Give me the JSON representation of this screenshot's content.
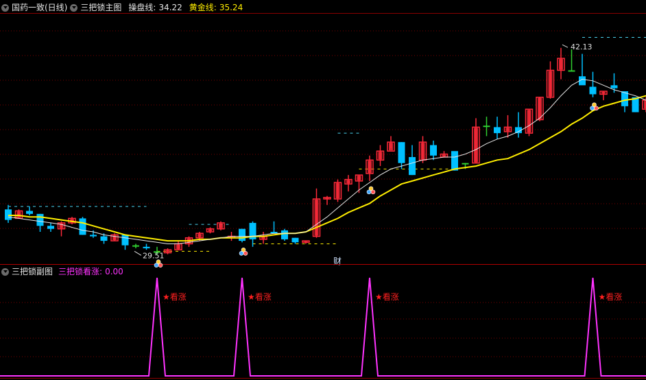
{
  "main": {
    "stock_title": "国药一致(日线)",
    "indicator_title": "三把锁主图",
    "line1_label": "操盘线:",
    "line1_value": "34.22",
    "line2_label": "黄金线:",
    "line2_value": "35.24",
    "high_label": "42.13",
    "low_label": "29.51",
    "marker": "财"
  },
  "sub": {
    "title": "三把锁副图",
    "series_label": "三把锁看涨:",
    "series_value": "0.00",
    "signal_label": "★看涨"
  },
  "colors": {
    "background": "#000000",
    "grid": "#7a0000",
    "up": "#ff2a3a",
    "down": "#00c0ff",
    "doji": "#30d030",
    "ma_white": "#e8e8e8",
    "ma_yellow": "#ffee00",
    "signal": "#ff33ff",
    "level": "#4cd2f0",
    "level_yellow": "#ffee00"
  },
  "chart_data": {
    "type": "candlestick",
    "price_range": [
      28.7,
      44.2
    ],
    "grid": true,
    "ohlc": [
      [
        31.3,
        31.6,
        30.4,
        30.6
      ],
      [
        30.7,
        31.3,
        30.7,
        31.2
      ],
      [
        31.2,
        31.5,
        30.9,
        31.0
      ],
      [
        31.0,
        31.0,
        29.8,
        30.2
      ],
      [
        30.2,
        30.4,
        29.8,
        30.0
      ],
      [
        30.0,
        30.5,
        29.5,
        30.4
      ],
      [
        30.4,
        30.8,
        30.3,
        30.7
      ],
      [
        30.7,
        30.8,
        29.6,
        29.6
      ],
      [
        29.6,
        29.9,
        29.4,
        29.5
      ],
      [
        29.5,
        29.7,
        29.0,
        29.2
      ],
      [
        29.2,
        29.7,
        29.2,
        29.6
      ],
      [
        29.6,
        29.6,
        28.6,
        28.9
      ],
      [
        28.9,
        29.0,
        28.7,
        28.9
      ],
      [
        28.8,
        29.0,
        28.6,
        28.7
      ],
      [
        28.5,
        28.8,
        28.3,
        28.5
      ],
      [
        28.4,
        28.7,
        28.3,
        28.6
      ],
      [
        28.6,
        29.2,
        28.6,
        29.0
      ],
      [
        29.0,
        29.5,
        28.8,
        29.4
      ],
      [
        29.4,
        29.8,
        29.2,
        29.7
      ],
      [
        29.8,
        30.1,
        29.7,
        30.0
      ],
      [
        30.0,
        30.5,
        29.9,
        30.4
      ],
      [
        29.4,
        29.8,
        29.2,
        29.5
      ],
      [
        30.0,
        30.0,
        29.1,
        29.2
      ],
      [
        30.4,
        30.5,
        28.8,
        29.3
      ],
      [
        29.3,
        29.8,
        29.0,
        29.5
      ],
      [
        29.8,
        30.5,
        29.7,
        29.7
      ],
      [
        29.9,
        30.0,
        29.2,
        29.3
      ],
      [
        29.4,
        29.4,
        29.0,
        29.1
      ],
      [
        29.1,
        29.2,
        29.0,
        29.2
      ],
      [
        29.5,
        32.7,
        29.4,
        32.0
      ],
      [
        32.0,
        32.2,
        31.6,
        32.1
      ],
      [
        32.0,
        33.3,
        31.8,
        33.1
      ],
      [
        33.0,
        33.6,
        32.5,
        33.3
      ],
      [
        33.2,
        33.6,
        32.4,
        33.6
      ],
      [
        33.7,
        34.9,
        33.2,
        34.6
      ],
      [
        34.6,
        35.6,
        34.2,
        35.2
      ],
      [
        35.2,
        36.2,
        35.4,
        35.8
      ],
      [
        35.8,
        35.8,
        34.0,
        34.4
      ],
      [
        34.8,
        35.6,
        33.6,
        33.6
      ],
      [
        34.6,
        36.2,
        34.4,
        35.8
      ],
      [
        35.6,
        35.9,
        34.6,
        34.9
      ],
      [
        34.8,
        35.2,
        34.8,
        35.0
      ],
      [
        35.2,
        34.6,
        33.9,
        33.9
      ],
      [
        34.4,
        34.4,
        34.0,
        34.4
      ],
      [
        34.4,
        37.4,
        34.4,
        36.8
      ],
      [
        36.9,
        37.5,
        36.2,
        36.9
      ],
      [
        36.8,
        37.5,
        36.0,
        36.4
      ],
      [
        36.5,
        37.6,
        36.1,
        36.8
      ],
      [
        36.8,
        37.8,
        36.1,
        36.4
      ],
      [
        36.4,
        38.0,
        36.2,
        38.0
      ],
      [
        37.3,
        38.8,
        37.2,
        38.8
      ],
      [
        38.8,
        41.2,
        38.7,
        40.6
      ],
      [
        40.6,
        42.1,
        40.0,
        41.4
      ],
      [
        40.6,
        42.0,
        40.6,
        40.6
      ],
      [
        40.2,
        41.7,
        40.0,
        39.6
      ],
      [
        39.5,
        40.5,
        38.8,
        39.0
      ],
      [
        39.0,
        39.2,
        38.6,
        39.2
      ],
      [
        39.6,
        40.4,
        39.1,
        39.4
      ],
      [
        39.2,
        38.8,
        37.8,
        38.2
      ],
      [
        38.8,
        38.3,
        37.8,
        37.8
      ],
      [
        38.0,
        38.8,
        37.8,
        38.6
      ],
      [
        38.3,
        39.2,
        37.9,
        38.8
      ],
      [
        38.6,
        38.8,
        36.4,
        36.8
      ],
      [
        36.8,
        36.4,
        35.4,
        35.9
      ],
      [
        35.6,
        36.2,
        35.3,
        35.6
      ],
      [
        35.6,
        35.8,
        35.3,
        35.6
      ],
      [
        35.6,
        35.8,
        35.4,
        35.6
      ],
      [
        35.6,
        35.8,
        35.4,
        35.8
      ],
      [
        36.0,
        36.5,
        35.7,
        36.3
      ],
      [
        36.6,
        37.1,
        36.4,
        37.1
      ],
      [
        37.0,
        37.6,
        36.5,
        37.2
      ],
      [
        37.0,
        37.8,
        36.8,
        37.5
      ],
      [
        37.1,
        38.0,
        37.0,
        37.4
      ],
      [
        37.6,
        37.5,
        36.8,
        36.9
      ],
      [
        36.4,
        36.6,
        35.5,
        35.7
      ],
      [
        35.8,
        35.8,
        34.3,
        34.8
      ]
    ],
    "ma_white": [
      30.8,
      30.7,
      30.6,
      30.5,
      30.4,
      30.3,
      30.1,
      29.9,
      29.8,
      29.6,
      29.5,
      29.4,
      29.3,
      29.2,
      29.1,
      29.0,
      29.0,
      29.1,
      29.2,
      29.3,
      29.4,
      29.5,
      29.5,
      29.5,
      29.6,
      29.7,
      29.7,
      29.7,
      29.8,
      30.3,
      30.8,
      31.4,
      32.0,
      32.6,
      33.1,
      33.6,
      34.0,
      34.2,
      34.4,
      34.6,
      34.7,
      34.8,
      34.8,
      35.0,
      35.3,
      35.7,
      36.0,
      36.2,
      36.5,
      36.9,
      37.4,
      38.1,
      38.9,
      39.6,
      40.0,
      39.9,
      39.6,
      39.3,
      39.1,
      38.9,
      38.6,
      38.4,
      38.2,
      37.8,
      37.5,
      37.0,
      36.6,
      36.3,
      36.1,
      36.1,
      36.3,
      36.6,
      36.9,
      36.9,
      36.6,
      36.2
    ],
    "ma_yellow": [
      30.9,
      30.9,
      30.8,
      30.8,
      30.7,
      30.6,
      30.5,
      30.4,
      30.2,
      30.0,
      29.8,
      29.6,
      29.5,
      29.4,
      29.3,
      29.2,
      29.2,
      29.2,
      29.3,
      29.3,
      29.4,
      29.4,
      29.4,
      29.5,
      29.5,
      29.6,
      29.7,
      29.7,
      29.8,
      30.1,
      30.4,
      30.7,
      31.1,
      31.4,
      31.7,
      32.2,
      32.6,
      33.0,
      33.2,
      33.4,
      33.6,
      33.8,
      34.0,
      34.1,
      34.2,
      34.4,
      34.6,
      34.7,
      35.0,
      35.3,
      35.7,
      36.1,
      36.5,
      37.0,
      37.4,
      37.9,
      38.2,
      38.4,
      38.6,
      38.7,
      38.9,
      39.0,
      38.9,
      38.7,
      38.4,
      38.1,
      37.9,
      37.7,
      37.5,
      37.4,
      37.3,
      37.2,
      37.2,
      37.1,
      36.9,
      36.6
    ],
    "signal_days": [
      14,
      22,
      34,
      55
    ],
    "signal_value": 10,
    "high_day": 52,
    "low_day": 12,
    "marker_day": 32
  }
}
